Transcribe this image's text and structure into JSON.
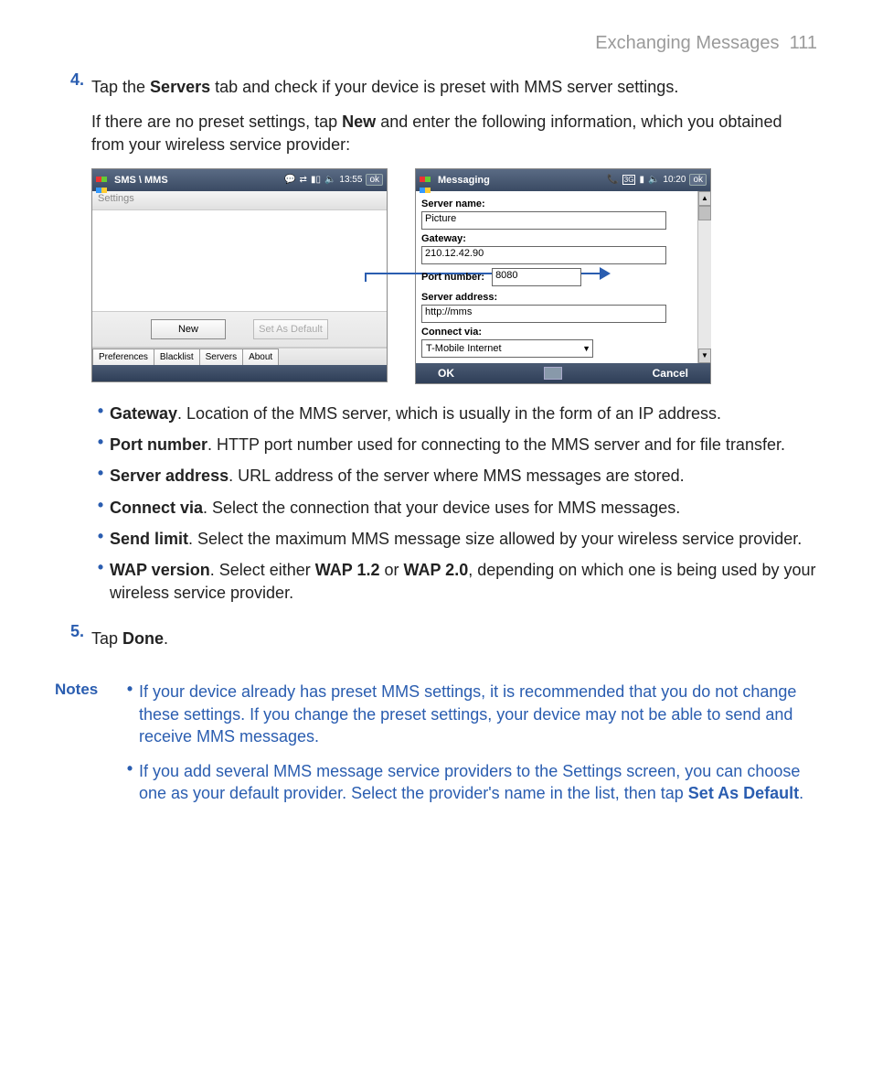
{
  "header": {
    "section": "Exchanging Messages",
    "page": "111"
  },
  "steps": {
    "s4": {
      "num": "4.",
      "p1a": "Tap the ",
      "p1b": "Servers",
      "p1c": " tab and check if your device is preset with MMS server settings.",
      "p2a": "If there are no preset settings, tap ",
      "p2b": "New",
      "p2c": " and enter the following information, which you obtained from your wireless service provider:"
    },
    "s5": {
      "num": "5.",
      "a": "Tap ",
      "b": "Done",
      "c": "."
    }
  },
  "shots": {
    "left": {
      "title": "SMS \\ MMS",
      "time": "13:55",
      "ok": "ok",
      "settings": "Settings",
      "new_btn": "New",
      "default_btn": "Set As Default",
      "tabs": [
        "Preferences",
        "Blacklist",
        "Servers",
        "About"
      ]
    },
    "right": {
      "title": "Messaging",
      "time": "10:20",
      "ok": "ok",
      "labels": {
        "server_name": "Server name:",
        "gateway": "Gateway:",
        "port": "Port number:",
        "server_addr": "Server address:",
        "connect": "Connect via:"
      },
      "values": {
        "server_name": "Picture",
        "gateway": "210.12.42.90",
        "port": "8080",
        "server_addr": "http://mms",
        "connect": "T-Mobile Internet"
      },
      "ok_btn": "OK",
      "cancel_btn": "Cancel"
    }
  },
  "bullets": {
    "gateway": {
      "t": "Gateway",
      "d": ". Location of the MMS server, which is usually in the form of an IP address."
    },
    "port": {
      "t": "Port number",
      "d": ". HTTP port number used for connecting to the MMS server and for file transfer."
    },
    "addr": {
      "t": "Server address",
      "d": ". URL address of the server where MMS messages are stored."
    },
    "conn": {
      "t": "Connect via",
      "d": ". Select the connection that your device uses for MMS messages."
    },
    "send": {
      "t": "Send limit",
      "d": ". Select the maximum MMS message size allowed by your wireless service provider."
    },
    "wap": {
      "t": "WAP version",
      "d1": ". Select either ",
      "d2": "WAP 1.2",
      "d3": " or ",
      "d4": "WAP 2.0",
      "d5": ", depending on which one is being used by your wireless service provider."
    }
  },
  "notes": {
    "label": "Notes",
    "n1": "If your device already has preset MMS settings, it is recommended that you do not change these settings. If you change the preset settings, your device may not be able to send and receive MMS messages.",
    "n2a": "If you add several MMS message service providers to the Settings screen, you can choose one as your default provider. Select the provider's name in the list, then tap ",
    "n2b": "Set As Default",
    "n2c": "."
  }
}
